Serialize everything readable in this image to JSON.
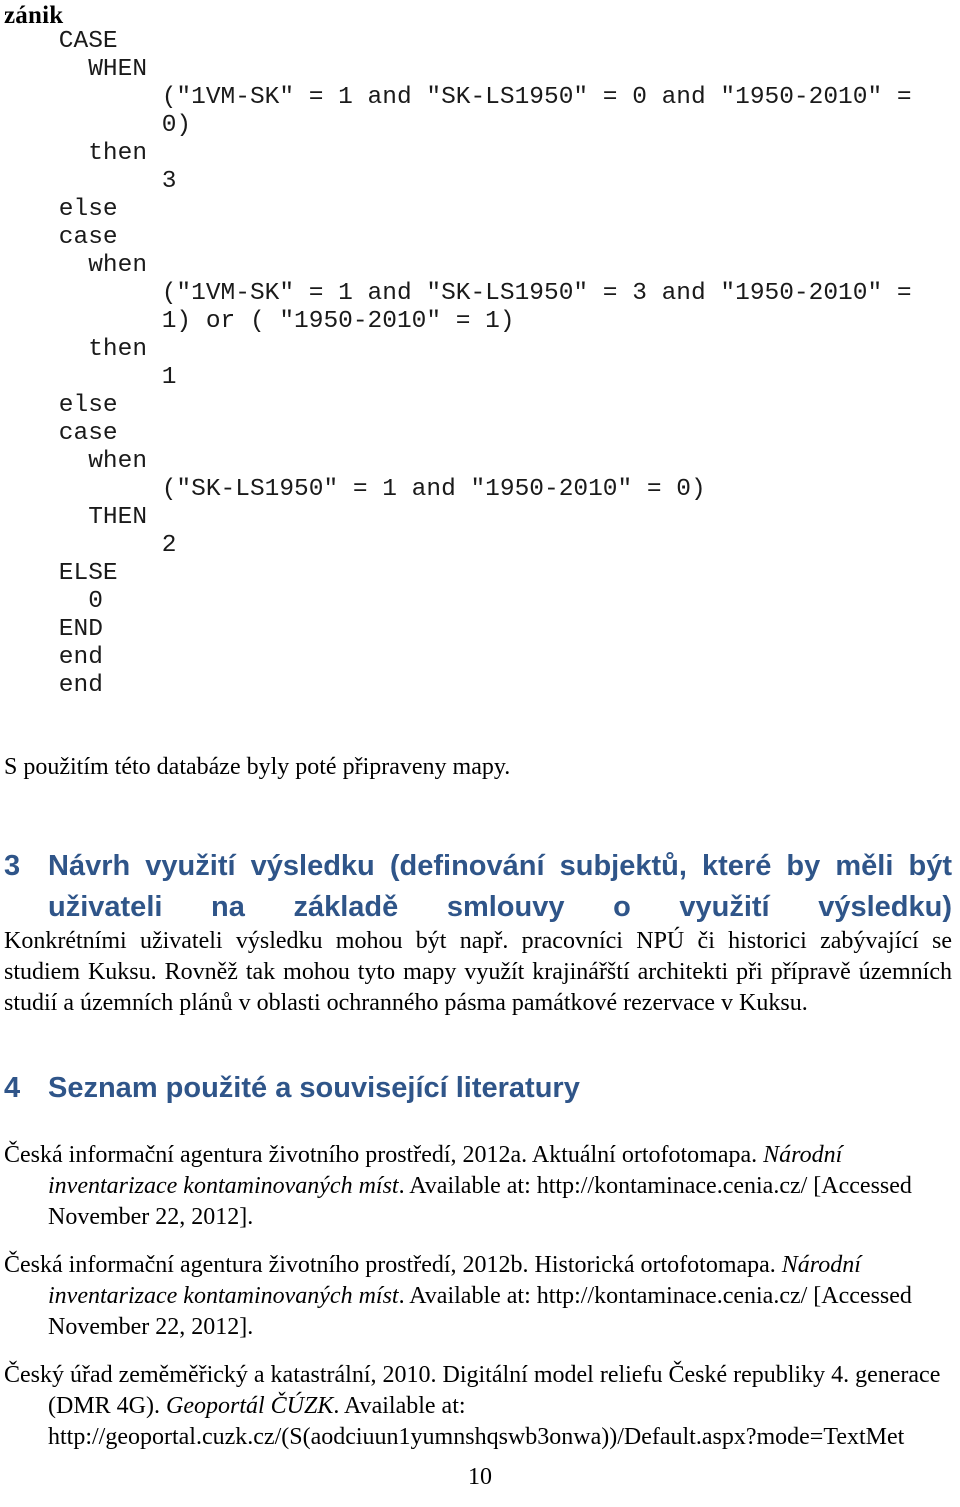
{
  "document": {
    "carry_word": "zánik",
    "page_number": "10",
    "heading_color": "#2f5589"
  },
  "code_block": {
    "language": "sql-case-expression",
    "lines": [
      "    CASE",
      "      WHEN",
      "           (\"1VM-SK\" = 1 and \"SK-LS1950\" = 0 and \"1950-2010\" =",
      "           0)",
      "      then",
      "           3",
      "    else",
      "    case",
      "      when",
      "           (\"1VM-SK\" = 1 and \"SK-LS1950\" = 3 and \"1950-2010\" =",
      "           1) or ( \"1950-2010\" = 1)",
      "      then",
      "           1",
      "    else",
      "    case",
      "      when",
      "           (\"SK-LS1950\" = 1 and \"1950-2010\" = 0)",
      "      THEN",
      "           2",
      "    ELSE",
      "      0",
      "    END",
      "    end",
      "    end"
    ]
  },
  "paragraphs": {
    "maps": "S použitím této databáze byly poté připraveny mapy.",
    "users": "Konkrétními uživateli výsledku mohou být např. pracovníci NPÚ či historici zabývající se studiem Kuksu. Rovněž tak mohou tyto mapy využít krajinářští architekti při přípravě územních studií a územních plánů v oblasti ochranného pásma památkové rezervace v Kuksu."
  },
  "headings": {
    "section3": {
      "number": "3",
      "title": "Návrh využití výsledku (definování subjektů, které by měli být uživateli na základě smlouvy o využití výsledku)"
    },
    "section4": {
      "number": "4",
      "title": "Seznam použité a související literatury"
    }
  },
  "references": [
    {
      "prefix": "Česká informační agentura životního prostředí, 2012a. Aktuální ortofotomapa. ",
      "italic": "Národní inventarizace kontaminovaných míst",
      "suffix": ". Available at: http://kontaminace.cenia.cz/ [Accessed November 22, 2012]."
    },
    {
      "prefix": "Česká informační agentura životního prostředí, 2012b. Historická ortofotomapa. ",
      "italic": "Národní inventarizace kontaminovaných míst",
      "suffix": ". Available at: http://kontaminace.cenia.cz/ [Accessed November 22, 2012]."
    },
    {
      "prefix": "Český úřad zeměměřický a katastrální, 2010. Digitální model reliefu České republiky 4. generace (DMR 4G). ",
      "italic": "Geoportál ČÚZK",
      "suffix": ". Available at: http://geoportal.cuzk.cz/(S(aodciuun1yumnshqswb3onwa))/Default.aspx?mode=TextMet"
    }
  ]
}
